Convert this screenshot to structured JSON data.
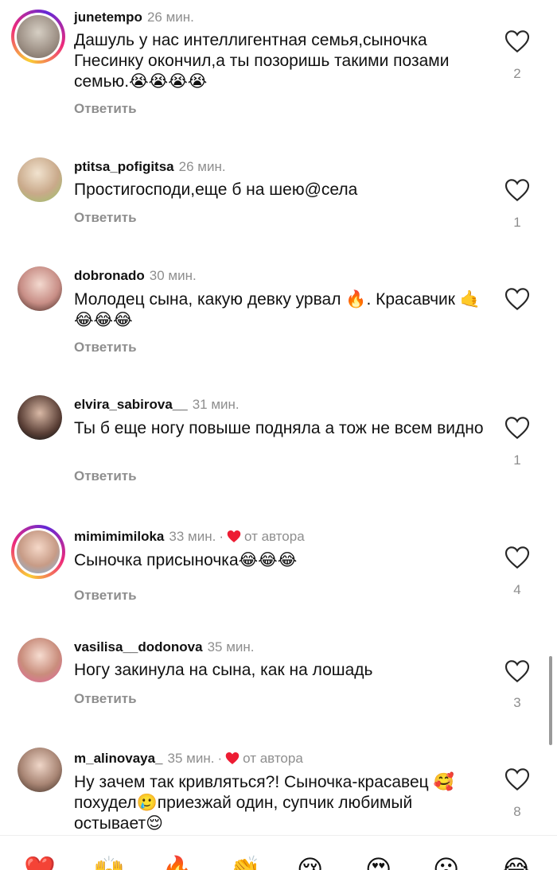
{
  "reply_label": "Ответить",
  "author_badge": "от автора",
  "comments": [
    {
      "username": "junetempo",
      "time": "26 мин.",
      "text": "Дашуль у нас интеллигентная семья,сыночка Гнесинку окончил,а ты позоришь такими позами семью.😭😭😭😭",
      "likes": "2"
    },
    {
      "username": "ptitsa_pofigitsa",
      "time": "26 мин.",
      "text": "Простигосподи,еще б на шею@села",
      "likes": "1"
    },
    {
      "username": "dobronado",
      "time": "30 мин.",
      "text": "Молодец сына, какую девку урвал 🔥. Красавчик 🤙😂😂😂",
      "likes": ""
    },
    {
      "username": "elvira_sabirova__",
      "time": "31 мин.",
      "text": "Ты б еще ногу повыше подняла а тож не всем видно",
      "likes": "1"
    },
    {
      "username": "mimimimiloka",
      "time": "33 мин.",
      "text": "Сыночка присыночка😂😂😂",
      "likes": "4"
    },
    {
      "username": "vasilisa__dodonova",
      "time": "35 мин.",
      "text": "Ногу закинула на сына, как на лошадь",
      "likes": "3"
    },
    {
      "username": "m_alinovaya_",
      "time": "35 мин.",
      "text": "Ну зачем так кривляться?! Сыночка-красавец 🥰 похудел🥲приезжай один, супчик любимый остывает😌",
      "likes": "8"
    }
  ],
  "emoji_bar": [
    "❤️",
    "🙌",
    "🔥",
    "👏",
    "😢",
    "😍",
    "😮",
    "😂"
  ],
  "colors": {
    "accent_heart": "#ed1c33",
    "muted": "#8e8e8e",
    "text": "#111111"
  }
}
